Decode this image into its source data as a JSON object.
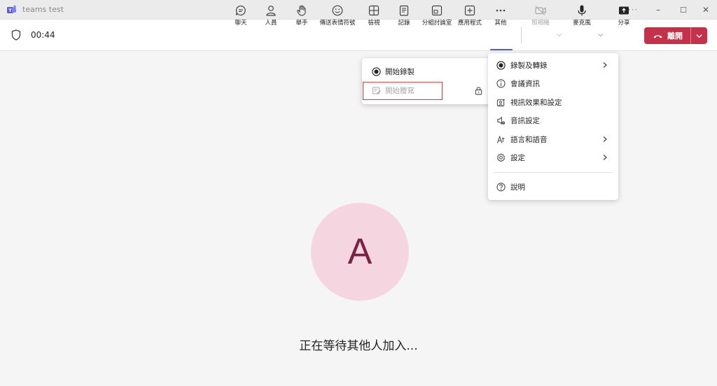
{
  "window": {
    "title": "teams test",
    "more_glyph": "···",
    "minimize_glyph": "–",
    "maximize_glyph": "☐",
    "close_glyph": "✕"
  },
  "meeting": {
    "timer": "00:44"
  },
  "toolbar": {
    "items": [
      {
        "label": "聊天",
        "icon": "chat-icon"
      },
      {
        "label": "人員",
        "icon": "people-icon"
      },
      {
        "label": "舉手",
        "icon": "raise-hand-icon"
      },
      {
        "label": "傳送表情符號",
        "icon": "emoji-icon"
      },
      {
        "label": "檢視",
        "icon": "view-grid-icon"
      },
      {
        "label": "記錄",
        "icon": "notes-icon"
      },
      {
        "label": "分組討論室",
        "icon": "breakout-icon"
      },
      {
        "label": "應用程式",
        "icon": "add-app-icon"
      },
      {
        "label": "其他",
        "icon": "more-icon"
      },
      {
        "label": "照相機",
        "icon": "camera-off-icon",
        "disabled": true
      },
      {
        "label": "麥克風",
        "icon": "mic-icon"
      },
      {
        "label": "分享",
        "icon": "share-icon"
      }
    ],
    "leave_label": "離開",
    "accent_color": "#5b5fc7",
    "leave_color": "#c4314b"
  },
  "submenu": {
    "items": [
      {
        "label": "開始錄製",
        "icon": "record-icon"
      },
      {
        "label": "開始謄寫",
        "icon": "transcript-icon",
        "disabled": true,
        "locked": true
      }
    ]
  },
  "more_menu": {
    "items": [
      {
        "label": "錄製及轉錄",
        "icon": "record-icon",
        "has_submenu": true
      },
      {
        "label": "會議資訊",
        "icon": "info-icon"
      },
      {
        "label": "視訊效果和設定",
        "icon": "video-effects-icon"
      },
      {
        "label": "音訊設定",
        "icon": "audio-settings-icon"
      },
      {
        "label": "語言和語音",
        "icon": "language-icon",
        "has_submenu": true
      },
      {
        "label": "設定",
        "icon": "settings-gear-icon",
        "has_submenu": true
      },
      {
        "label": "說明",
        "icon": "help-icon"
      }
    ]
  },
  "stage": {
    "avatar_initial": "A",
    "waiting_text": "正在等待其他人加入..."
  }
}
